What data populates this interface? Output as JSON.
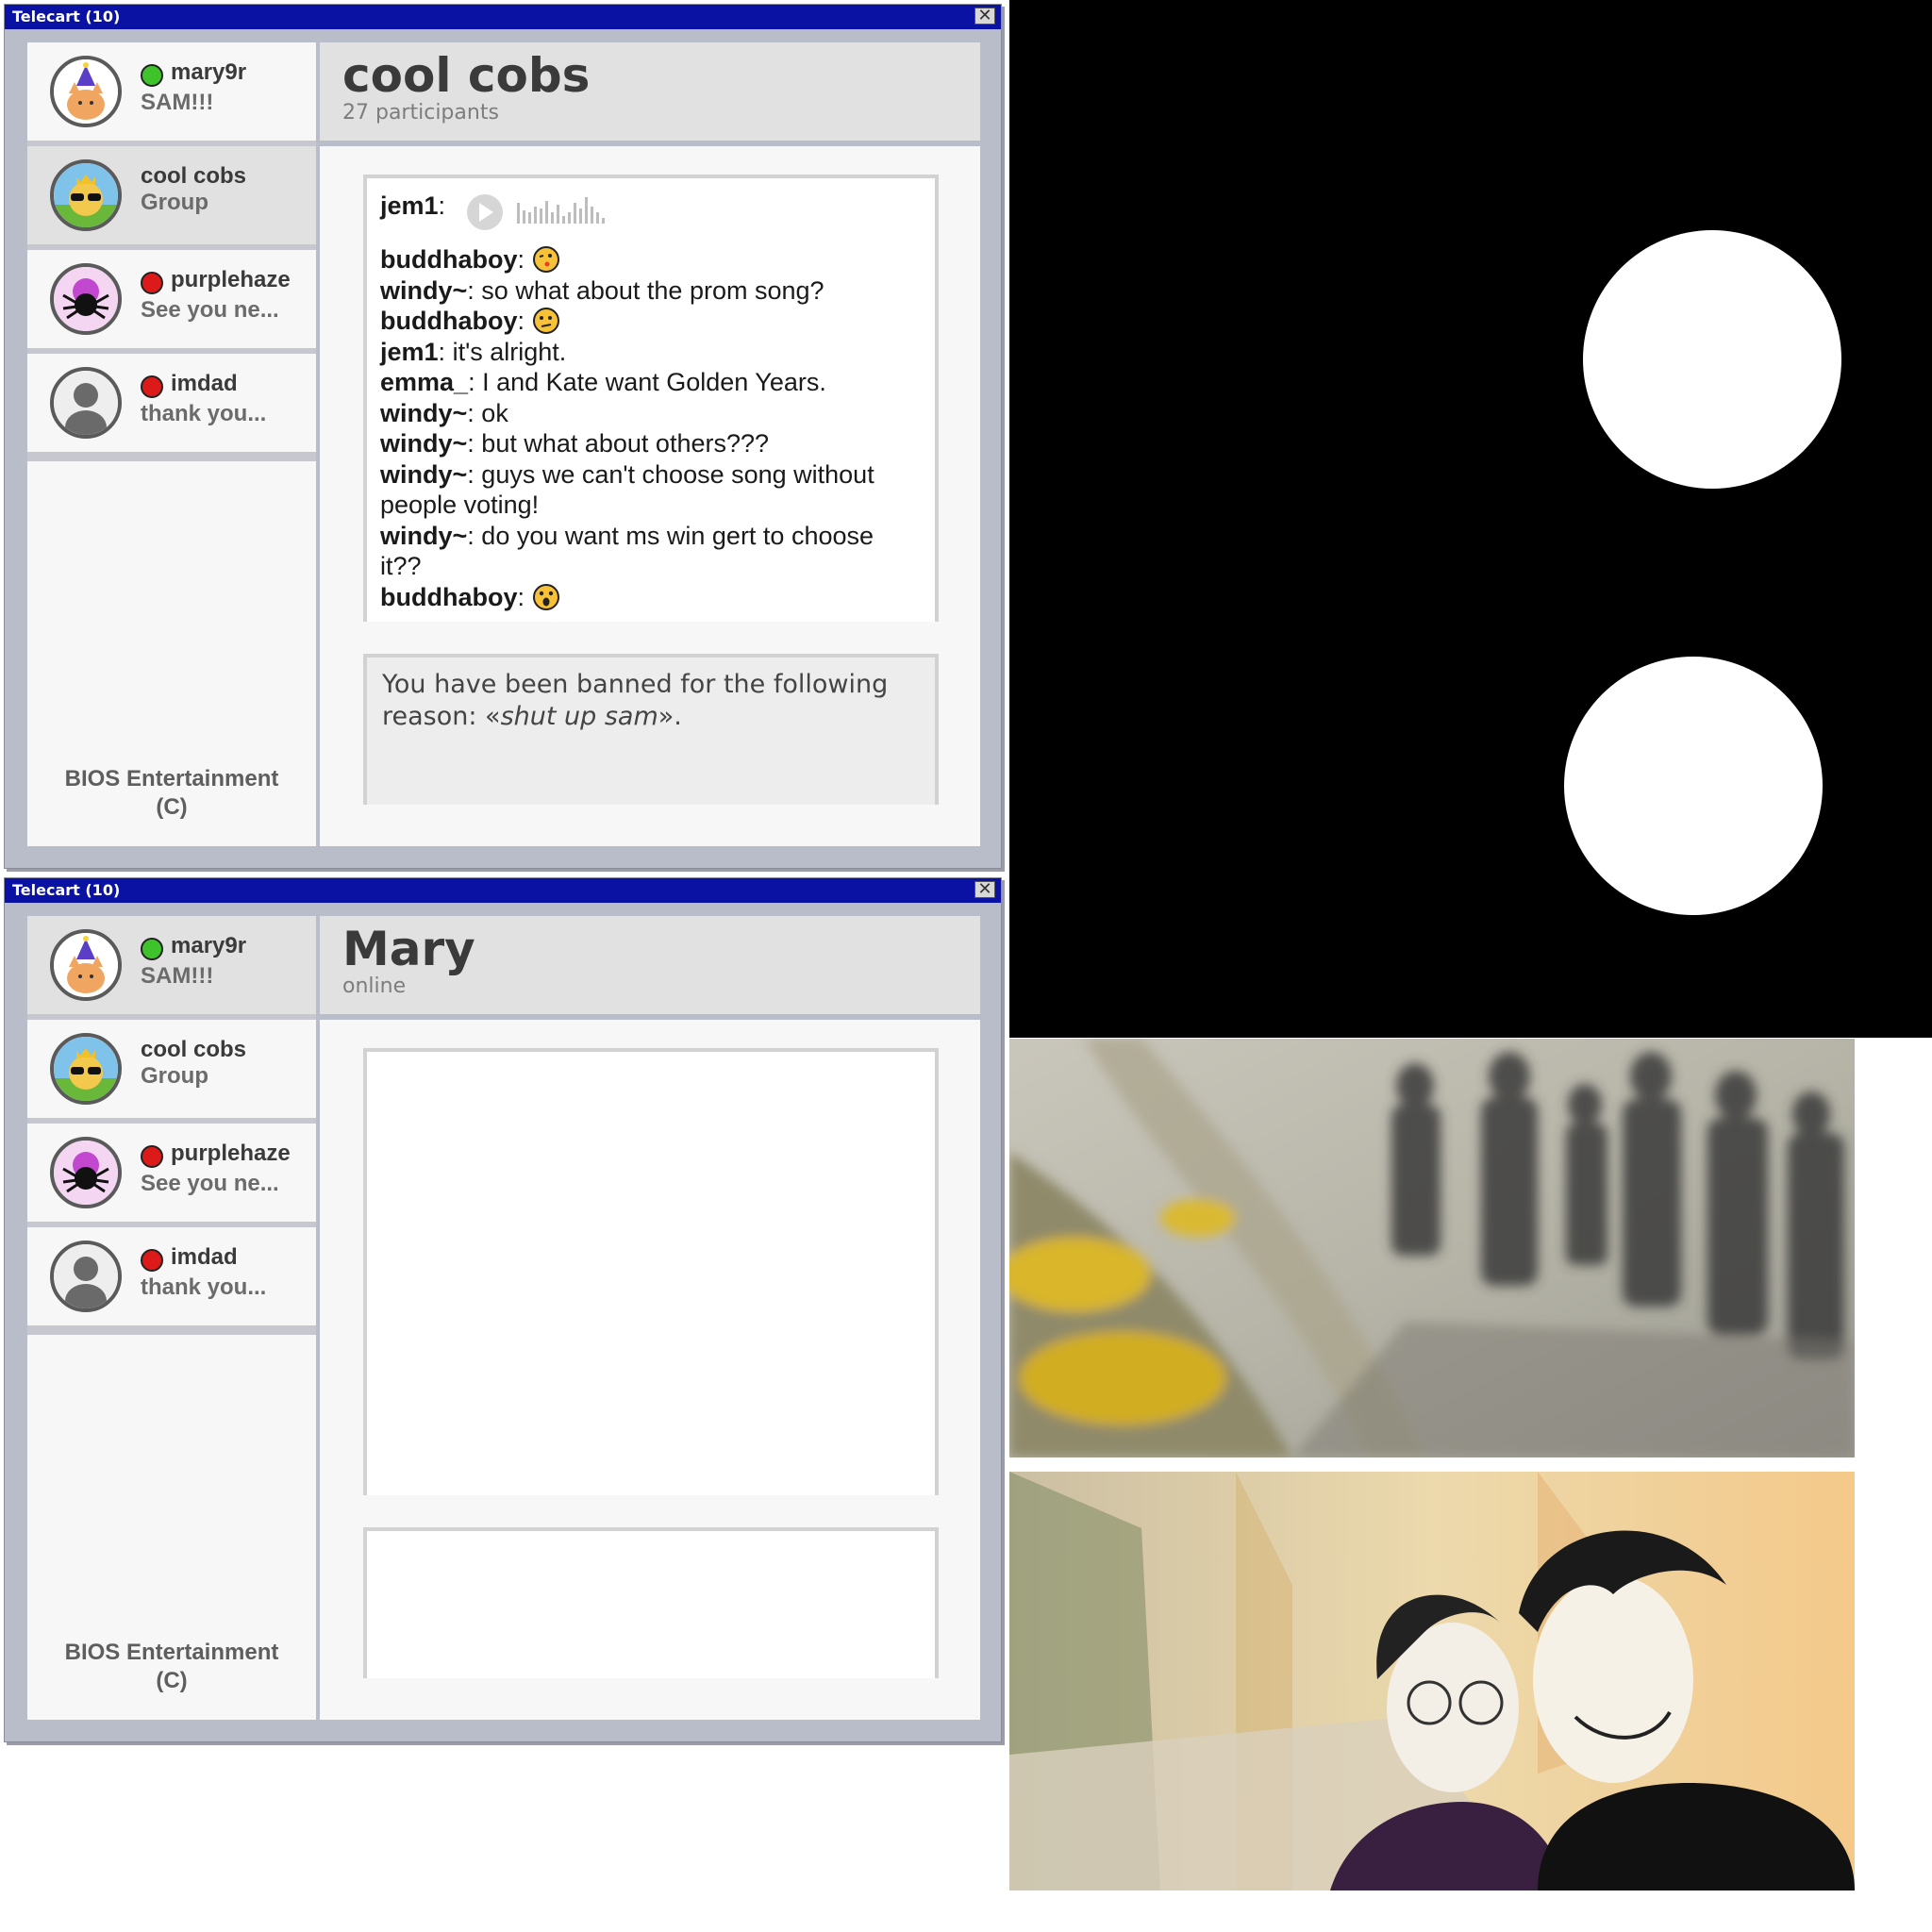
{
  "windows": [
    {
      "title": "Telecart (10)",
      "close_glyph": "✕",
      "contacts": [
        {
          "name": "mary9r",
          "sub": "SAM!!!",
          "status": "online"
        },
        {
          "name": "cool cobs",
          "sub": "Group",
          "status": "none"
        },
        {
          "name": "purplehaze",
          "sub": "See you ne...",
          "status": "offline"
        },
        {
          "name": "imdad",
          "sub": "thank you...",
          "status": "offline"
        }
      ],
      "footer": {
        "line1": "BIOS Entertainment",
        "line2": "(C)"
      },
      "header": {
        "title": "cool cobs",
        "subtitle": "27 participants"
      },
      "messages": [
        {
          "user": "jem1",
          "sep": ":",
          "text": "",
          "attachment": "audio"
        },
        {
          "user": "buddhaboy",
          "sep": ":",
          "text": "",
          "attachment": "emoji-kiss-wink"
        },
        {
          "user": "windy~",
          "sep": ":",
          "text": " so what about the prom song?"
        },
        {
          "user": "buddhaboy",
          "sep": ":",
          "text": "",
          "attachment": "emoji-thinking"
        },
        {
          "user": "jem1",
          "sep": ":",
          "text": " it's alright."
        },
        {
          "user": "emma_",
          "sep": ":",
          "text": " I and Kate want Golden Years."
        },
        {
          "user": "windy~",
          "sep": ":",
          "text": " ok"
        },
        {
          "user": "windy~",
          "sep": ":",
          "text": " but what about others???"
        },
        {
          "user": "windy~",
          "sep": ":",
          "text": " guys we can't choose song without people voting!"
        },
        {
          "user": "windy~",
          "sep": ":",
          "text": " do you want ms win gert to choose it??"
        },
        {
          "user": "buddhaboy",
          "sep": ":",
          "text": "",
          "attachment": "emoji-surprised"
        }
      ],
      "input": {
        "before": "You have been banned for the following reason: «",
        "italic": "shut up sam",
        "after": "»."
      }
    },
    {
      "title": "Telecart (10)",
      "close_glyph": "✕",
      "contacts": [
        {
          "name": "mary9r",
          "sub": "SAM!!!",
          "status": "online"
        },
        {
          "name": "cool cobs",
          "sub": "Group",
          "status": "none"
        },
        {
          "name": "purplehaze",
          "sub": "See you ne...",
          "status": "offline"
        },
        {
          "name": "imdad",
          "sub": "thank you...",
          "status": "offline"
        }
      ],
      "footer": {
        "line1": "BIOS Entertainment",
        "line2": "(C)"
      },
      "header": {
        "title": "Mary",
        "subtitle": "online"
      }
    }
  ],
  "colors": {
    "titlebar": "#0a12a4",
    "online": "#3ec42a",
    "offline": "#dd1a1a"
  }
}
